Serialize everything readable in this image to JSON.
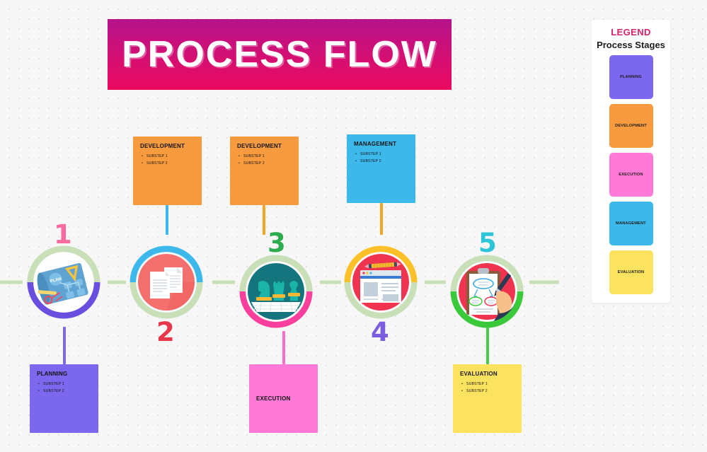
{
  "header": {
    "title": "PROCESS FLOW"
  },
  "legend": {
    "title": "LEGEND",
    "subtitle": "Process Stages",
    "items": [
      {
        "label": "PLANNING",
        "color": "#7b68ee"
      },
      {
        "label": "DEVELOPMENT",
        "color": "#f89b3e"
      },
      {
        "label": "EXECUTION",
        "color": "#fe7ad6"
      },
      {
        "label": "MANAGEMENT",
        "color": "#3cb8ea"
      },
      {
        "label": "EVALUATION",
        "color": "#fbe25f"
      }
    ]
  },
  "notes": {
    "top": [
      {
        "title": "DEVELOPMENT",
        "color": "#f89b3e",
        "substeps": [
          "SUBSTEP 1",
          "SUBSTEP 2"
        ],
        "connector_color": "#3cb8ea"
      },
      {
        "title": "DEVELOPMENT",
        "color": "#f89b3e",
        "substeps": [
          "SUBSTEP 1",
          "SUBSTEP 2"
        ],
        "connector_color": "#f5a623"
      },
      {
        "title": "MANAGEMENT",
        "color": "#3cb8ea",
        "substeps": [
          "SUBSTEP 1",
          "SUBSTEP 2"
        ],
        "connector_color": "#f5a623"
      }
    ],
    "bottom": [
      {
        "title": "PLANNING",
        "color": "#7b68ee",
        "substeps": [
          "SUBSTEP 1",
          "SUBSTEP 2"
        ],
        "connector_color": "#7b68ee"
      },
      {
        "title": "EXECUTION",
        "color": "#fe7ad6",
        "substeps": [],
        "connector_color": "#fb6ec6"
      },
      {
        "title": "EVALUATION",
        "color": "#fbe25f",
        "substeps": [
          "SUBSTEP 1",
          "SUBSTEP 2"
        ],
        "connector_color": "#4cc94c"
      }
    ]
  },
  "nodes": [
    {
      "number": "1",
      "number_color": "#f76ba0",
      "icon": "blueprint-planning-icon",
      "top_arc_color": "#c9dfb8",
      "bottom_arc_color": "#6a4ee0"
    },
    {
      "number": "2",
      "number_color": "#e8374a",
      "icon": "documents-icon",
      "top_arc_color": "#3cb8ea",
      "bottom_arc_color": "#c9dfb8"
    },
    {
      "number": "3",
      "number_color": "#2eaa4f",
      "icon": "chess-strategy-icon",
      "top_arc_color": "#c9dfb8",
      "bottom_arc_color": "#fb3f9c"
    },
    {
      "number": "4",
      "number_color": "#7b5de0",
      "icon": "web-layout-pencil-icon",
      "top_arc_color": "#fcc129",
      "bottom_arc_color": "#c9dfb8"
    },
    {
      "number": "5",
      "number_color": "#2ec4d8",
      "icon": "clipboard-review-icon",
      "top_arc_color": "#c9dfb8",
      "bottom_arc_color": "#3ac93a"
    }
  ],
  "flow": {
    "line_color": "#c9dfb8"
  }
}
